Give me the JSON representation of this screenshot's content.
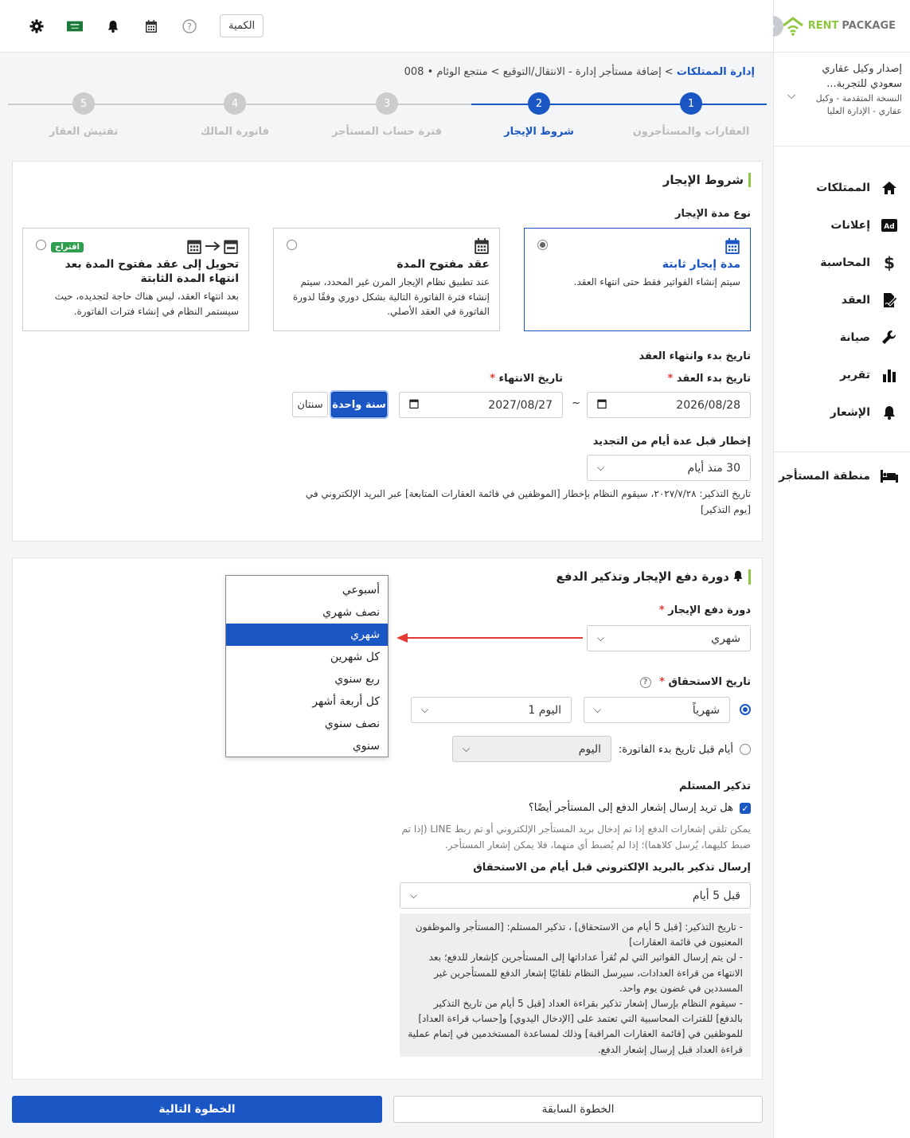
{
  "brand": {
    "rent": "RENT",
    "package": "PACKAGE"
  },
  "account": {
    "name": "إصدار وكيل عقاري سعودي للتجربة...",
    "sub": "النسخة المتقدمة - وكيل عقاري - الإدارة العليا"
  },
  "sidebar": {
    "items": [
      {
        "label": "الممتلكات",
        "icon": "home-icon"
      },
      {
        "label": "إعلانات",
        "icon": "ad-icon"
      },
      {
        "label": "المحاسبة",
        "icon": "dollar-icon"
      },
      {
        "label": "العقد",
        "icon": "contract-icon"
      },
      {
        "label": "صيانة",
        "icon": "wrench-icon"
      },
      {
        "label": "تقرير",
        "icon": "chart-icon"
      },
      {
        "label": "الإشعار",
        "icon": "bell-icon"
      }
    ],
    "tenant_area": "منطقة المستأجر"
  },
  "topbar": {
    "quantity_label": "الكمية"
  },
  "breadcrumb": {
    "root": "إدارة الممتلكات",
    "rest": " > إضافة مستأجر إدارة - الانتقال/التوقيع > منتجع الوئام • 008"
  },
  "steps": [
    {
      "number": "1",
      "label": "العقارات والمستأجرون"
    },
    {
      "number": "2",
      "label": "شروط الإيجار"
    },
    {
      "number": "3",
      "label": "فترة حساب المستأجر"
    },
    {
      "number": "4",
      "label": "فاتورة المالك"
    },
    {
      "number": "5",
      "label": "تفتيش العقار"
    }
  ],
  "lease_terms": {
    "title": "شروط الإيجار",
    "type_label": "نوع مدة الإيجار",
    "options": [
      {
        "title": "مدة إيجار ثابتة",
        "desc": "سيتم إنشاء الفواتير فقط حتى انتهاء العقد."
      },
      {
        "title": "عقد مفتوح المدة",
        "desc": "عند تطبيق نظام الإيجار المرن غير المحدد، سيتم إنشاء فترة الفاتورة التالية بشكل دوري وفقًا لدورة الفاتورة في العقد الأصلي."
      },
      {
        "title": "تحويل إلى عقد مفتوح المدة بعد انتهاء المدة الثابتة",
        "desc": "بعد انتهاء العقد، ليس هناك حاجة لتجديده، حيث سيستمر النظام في إنشاء فترات الفاتورة.",
        "badge": "اقتراح"
      }
    ],
    "dates_heading": "تاريخ بدء وانتهاء العقد",
    "start_label": "تاريخ بدء العقد",
    "end_label": "تاريخ الانتهاء",
    "start_value": "2026/08/28",
    "end_value": "2027/08/27",
    "tilde": "~",
    "one_year": "سنة واحدة",
    "two_years": "سنتان",
    "notify_label": "إخطار قبل عدة أيام من التجديد",
    "notify_value": "30 منذ أيام",
    "notify_note": "تاريخ التذكير: ٢٠٢٧/٧/٢٨، سيقوم النظام بإخطار [الموظفين في قائمة العقارات المتابعة] عبر البريد الإلكتروني في [يوم التذكير]"
  },
  "payment": {
    "title": "دورة دفع الإيجار وتذكير الدفع",
    "cycle_label": "دورة دفع الإيجار",
    "cycle_value": "شهري",
    "due_label": "تاريخ الاستحقاق",
    "due_period": "شهرياً",
    "due_day": "اليوم 1",
    "days_before_label": "أيام قبل تاريخ بدء الفاتورة:",
    "days_before_value": "اليوم",
    "recipient_label": "تذكير المستلم",
    "send_tenant_label": "هل تريد إرسال إشعار الدفع إلى المستأجر أيضًا؟",
    "send_tenant_note": "يمكن تلقي إشعارات الدفع إذا تم إدخال بريد المستأجر الإلكتروني أو تم ربط LINE (إذا تم ضبط كليهما، يُرسل كلاهما)؛ إذا لم يُضبط أي منهما، فلا يمكن إشعار المستأجر.",
    "email_reminder_label": "إرسال تذكير بالبريد الإلكتروني قبل أيام من الاستحقاق",
    "email_reminder_value": "قبل 5 أيام",
    "info_lines": [
      "- تاريخ التذكير: [قبل 5 أيام من الاستحقاق] ، تذكير المستلم: [المستأجر والموظفون المعنيون في قائمة العقارات]",
      "- لن يتم إرسال الفواتير التي لم تُقرأ عداداتها إلى المستأجرين كإشعار للدفع؛ بعد الانتهاء من قراءة العدادات، سيرسل النظام تلقائيًا إشعار الدفع للمستأجرين غير المسددين في غضون يوم واحد.",
      "- سيقوم النظام بإرسال إشعار تذكير بقراءة العداد [قبل 5 أيام من تاريخ التذكير بالدفع] للفترات المحاسبية التي تعتمد على [الإدخال اليدوي] و[حساب قراءة العداد] للموظفين في [قائمة العقارات المراقبة] وذلك لمساعدة المستخدمين في إتمام عملية قراءة العداد قبل إرسال إشعار الدفع."
    ],
    "cycle_options": [
      "أسبوعي",
      "نصف شهري",
      "شهري",
      "كل شهرين",
      "ربع سنوي",
      "كل أربعة أشهر",
      "نصف سنوي",
      "سنوي"
    ]
  },
  "footer": {
    "prev": "الخطوة السابقة",
    "next": "الخطوة التالية"
  },
  "colors": {
    "primary": "#1a56c4",
    "accent_green": "#8dc63f",
    "arrow_red": "#e53935"
  }
}
